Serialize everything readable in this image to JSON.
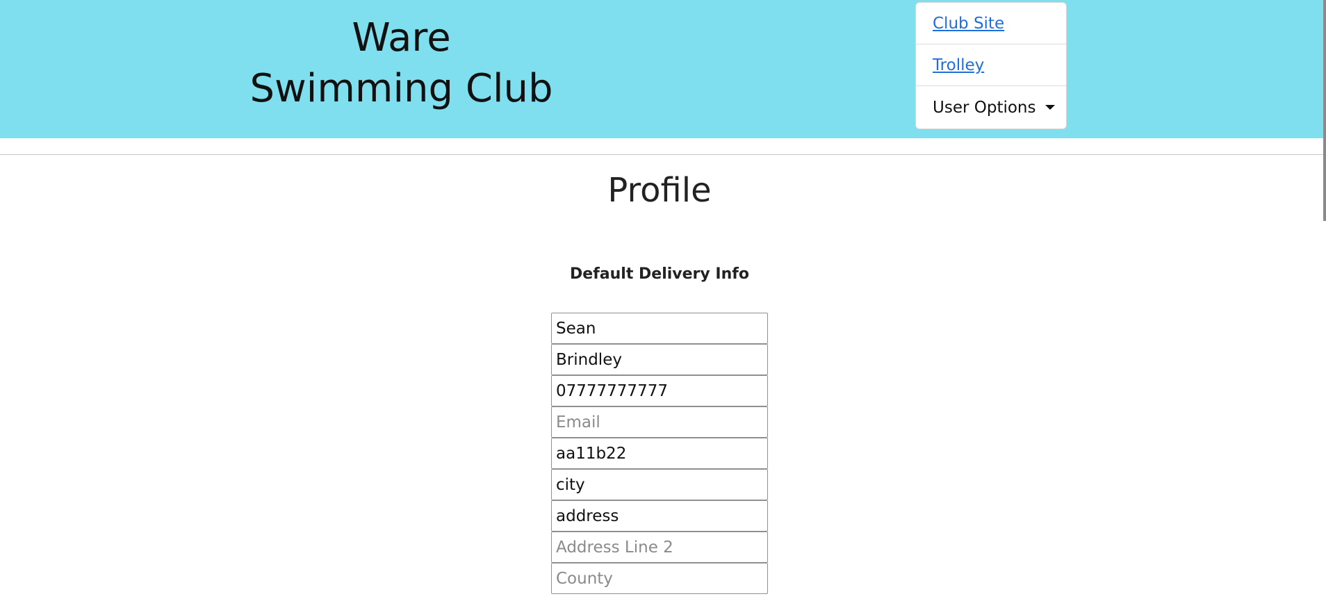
{
  "header": {
    "brand_line1": "Ware",
    "brand_line2": "Swimming Club",
    "background": "#7fdfef"
  },
  "nav": {
    "club_site": "Club Site",
    "trolley": "Trolley",
    "user_options": "User Options",
    "link_color": "#1f6fd8"
  },
  "page": {
    "title": "Profile",
    "section_heading": "Default Delivery Info"
  },
  "form": {
    "first_name": {
      "value": "Sean",
      "placeholder": ""
    },
    "last_name": {
      "value": "Brindley",
      "placeholder": ""
    },
    "phone": {
      "value": "07777777777",
      "placeholder": ""
    },
    "email": {
      "value": "",
      "placeholder": "Email"
    },
    "postcode": {
      "value": "aa11b22",
      "placeholder": ""
    },
    "city": {
      "value": "city",
      "placeholder": ""
    },
    "address_line1": {
      "value": "address",
      "placeholder": ""
    },
    "address_line2": {
      "value": "",
      "placeholder": "Address Line 2"
    },
    "county": {
      "value": "",
      "placeholder": "County"
    }
  }
}
